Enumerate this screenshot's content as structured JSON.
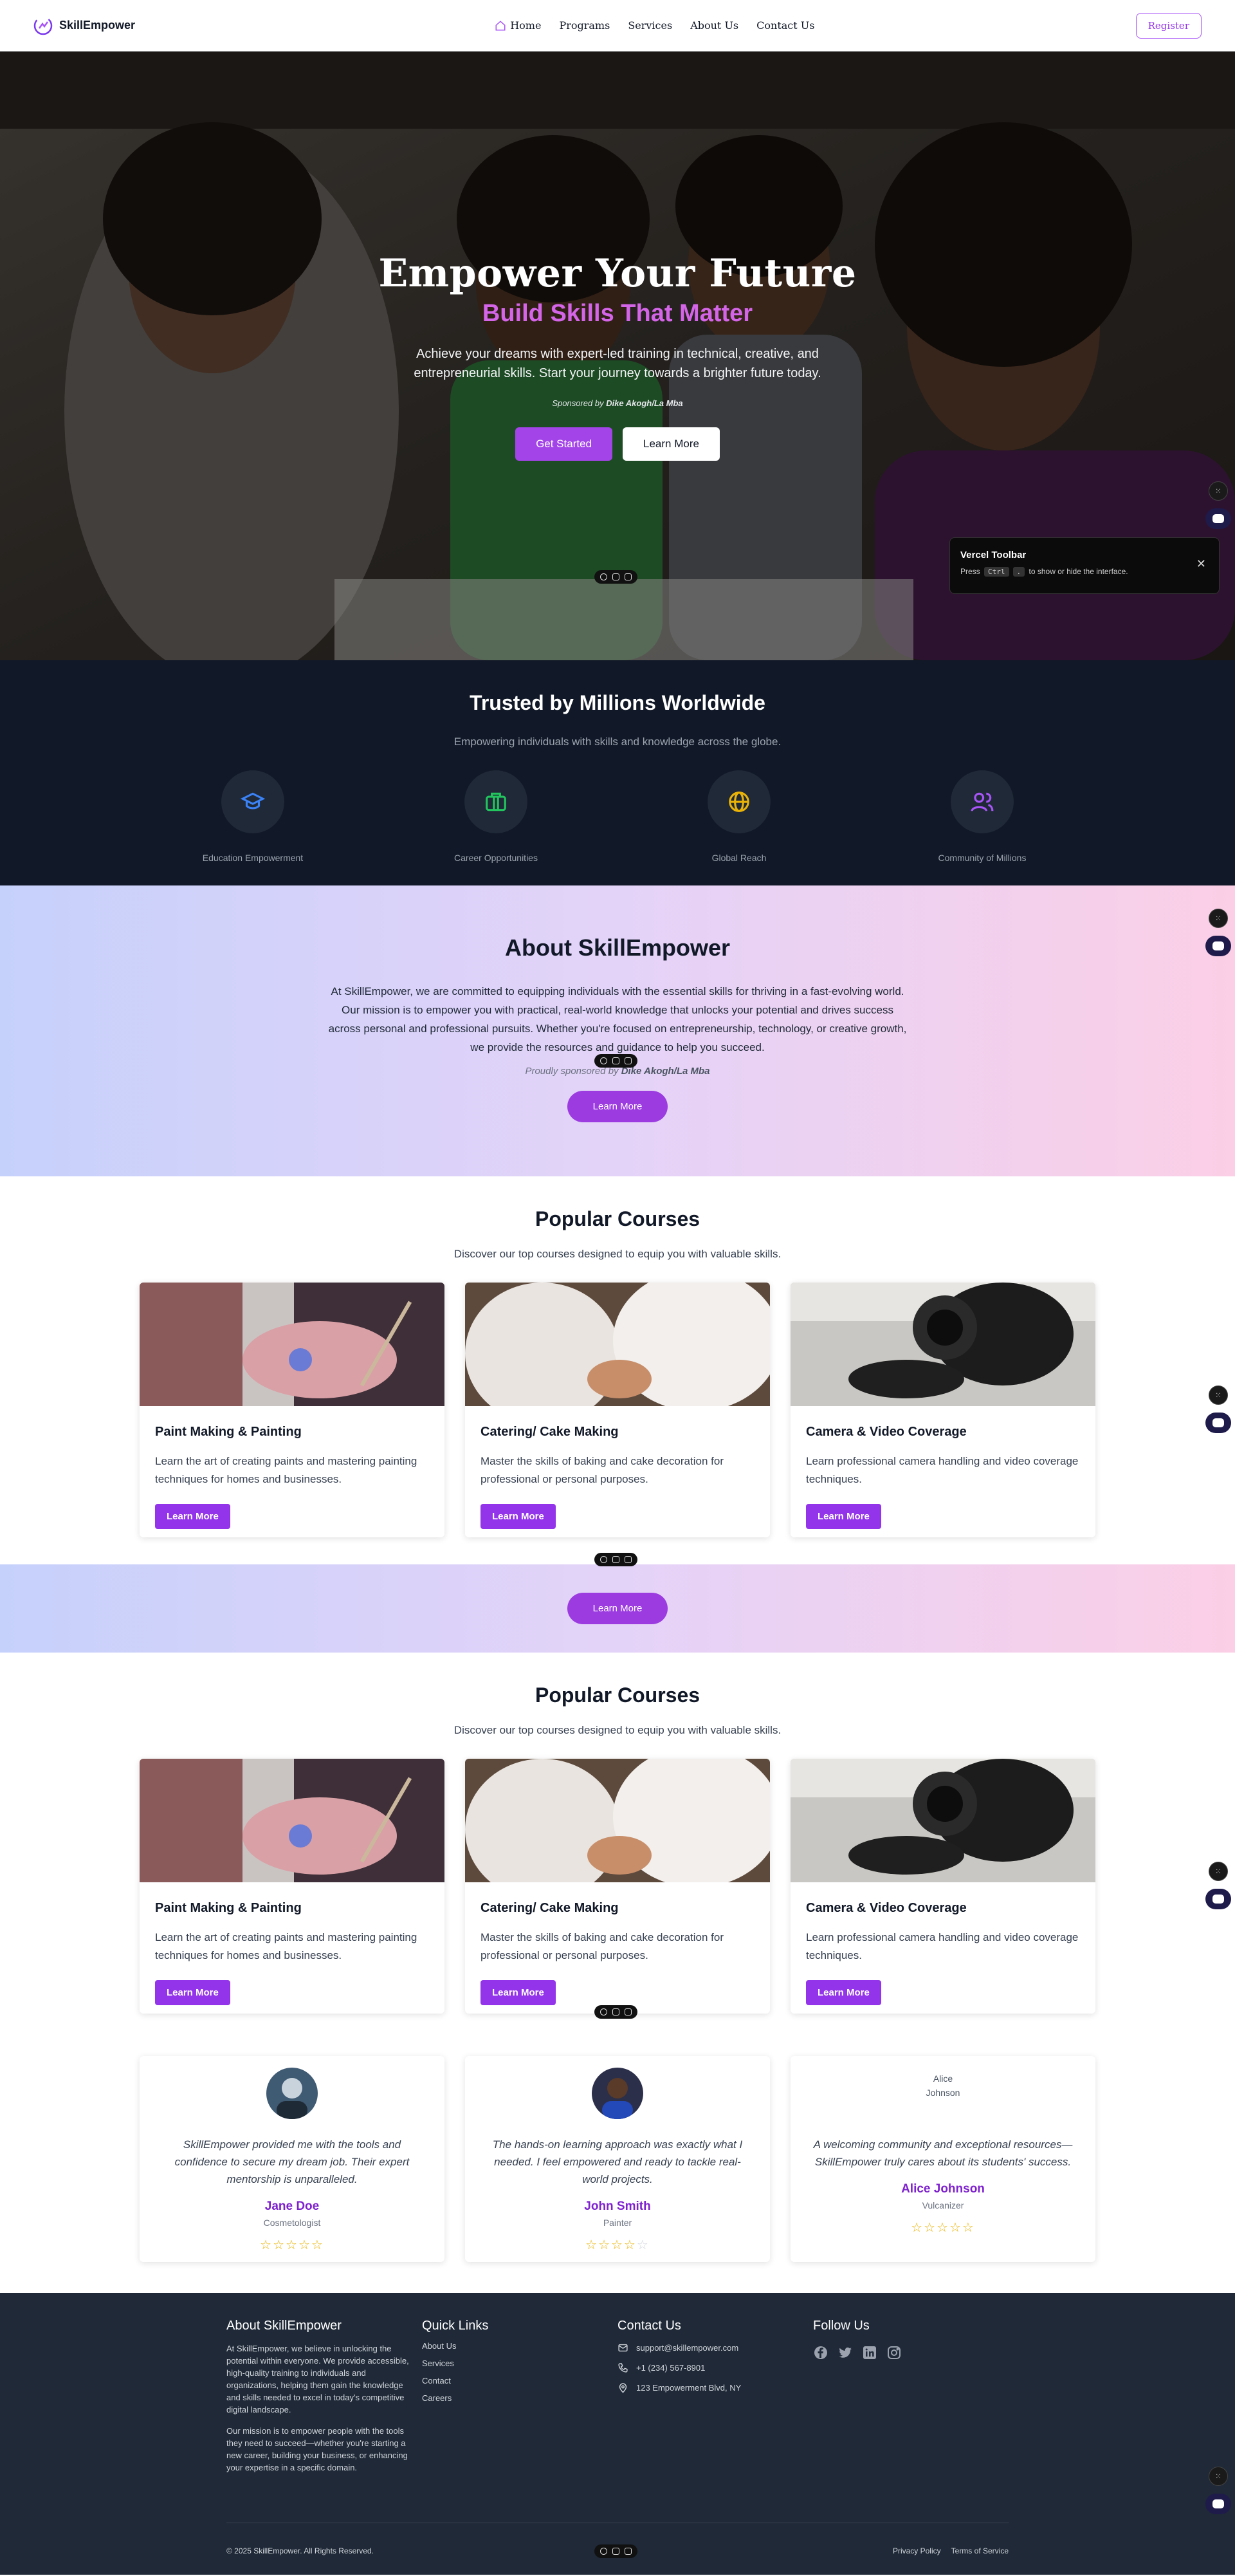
{
  "nav": {
    "brand": "SkillEmpower",
    "links": [
      {
        "label": "Home",
        "icon": "home-icon"
      },
      {
        "label": "Programs"
      },
      {
        "label": "Services"
      },
      {
        "label": "About Us"
      },
      {
        "label": "Contact Us"
      }
    ],
    "register_label": "Register"
  },
  "hero": {
    "title": "Empower Your Future",
    "subtitle": "Build Skills That Matter",
    "description": "Achieve your dreams with expert-led training in technical, creative, and entrepreneurial skills. Start your journey towards a brighter future today.",
    "sponsor_prefix": "Sponsored by",
    "sponsor_name": "Dike Akogh/La Mba",
    "primary_button": "Get Started",
    "secondary_button": "Learn More"
  },
  "vercel_toolbar": {
    "title": "Vercel Toolbar",
    "desc_before": "Press",
    "key": "Ctrl",
    "key2": ".",
    "desc_after": "to show or hide the interface."
  },
  "trusted": {
    "title": "Trusted by Millions Worldwide",
    "subtitle": "Empowering individuals with skills and knowledge across the globe.",
    "stats": [
      {
        "label": "Education Empowerment",
        "icon": "graduation-cap-icon",
        "color": "#3b82f6"
      },
      {
        "label": "Career Opportunities",
        "icon": "briefcase-icon",
        "color": "#22c55e"
      },
      {
        "label": "Global Reach",
        "icon": "globe-icon",
        "color": "#eab308"
      },
      {
        "label": "Community of Millions",
        "icon": "users-icon",
        "color": "#a855f7"
      }
    ]
  },
  "about": {
    "title": "About SkillEmpower",
    "text": "At SkillEmpower, we are committed to equipping individuals with the essential skills for thriving in a fast-evolving world. Our mission is to empower you with practical, real-world knowledge that unlocks your potential and drives success across personal and professional pursuits. Whether you're focused on entrepreneurship, technology, or creative growth, we provide the resources and guidance to help you succeed.",
    "sponsor_prefix": "Proudly sponsored by",
    "sponsor_name": "Dike Akogh/La Mba",
    "button": "Learn More"
  },
  "courses": [
    {
      "title": "Popular Courses",
      "subtitle": "Discover our top courses designed to equip you with valuable skills.",
      "items": [
        {
          "title": "Paint Making & Painting",
          "desc": "Learn the art of creating paints and mastering painting techniques for homes and businesses.",
          "button": "Learn More"
        },
        {
          "title": "Catering/ Cake Making",
          "desc": "Master the skills of baking and cake decoration for professional or personal purposes.",
          "button": "Learn More"
        },
        {
          "title": "Camera & Video Coverage",
          "desc": "Learn professional camera handling and video coverage techniques.",
          "button": "Learn More"
        }
      ]
    },
    {
      "title": "Popular Courses",
      "subtitle": "Discover our top courses designed to equip you with valuable skills.",
      "items": [
        {
          "title": "Paint Making & Painting",
          "desc": "Learn the art of creating paints and mastering painting techniques for homes and businesses.",
          "button": "Learn More"
        },
        {
          "title": "Catering/ Cake Making",
          "desc": "Master the skills of baking and cake decoration for professional or personal purposes.",
          "button": "Learn More"
        },
        {
          "title": "Camera & Video Coverage",
          "desc": "Learn professional camera handling and video coverage techniques.",
          "button": "Learn More"
        }
      ]
    }
  ],
  "band_button": "Learn More",
  "testimonials": [
    {
      "quote": "SkillEmpower provided me with the tools and confidence to secure my dream job. Their expert mentorship is unparalleled.",
      "name": "Jane Doe",
      "role": "Cosmetologist",
      "rating": 5
    },
    {
      "quote": "The hands-on learning approach was exactly what I needed. I feel empowered and ready to tackle real-world projects.",
      "name": "John Smith",
      "role": "Painter",
      "rating": 4
    },
    {
      "quote": "A welcoming community and exceptional resources—SkillEmpower truly cares about its students' success.",
      "name": "Alice Johnson",
      "role": "Vulcanizer",
      "rating": 5,
      "avatar_alt_line1": "Alice",
      "avatar_alt_line2": "Johnson"
    }
  ],
  "footer": {
    "about_title": "About SkillEmpower",
    "about_p1": "At SkillEmpower, we believe in unlocking the potential within everyone. We provide accessible, high-quality training to individuals and organizations, helping them gain the knowledge and skills needed to excel in today's competitive digital landscape.",
    "about_p2": "Our mission is to empower people with the tools they need to succeed—whether you're starting a new career, building your business, or enhancing your expertise in a specific domain.",
    "quick_title": "Quick Links",
    "quick_links": [
      "About Us",
      "Services",
      "Contact",
      "Careers"
    ],
    "contact_title": "Contact Us",
    "email": "support@skillempower.com",
    "phone": "+1 (234) 567-8901",
    "address": "123 Empowerment Blvd, NY",
    "follow_title": "Follow Us",
    "copyright": "© 2025 SkillEmpower. All Rights Reserved.",
    "privacy": "Privacy Policy",
    "terms": "Terms of Service"
  }
}
